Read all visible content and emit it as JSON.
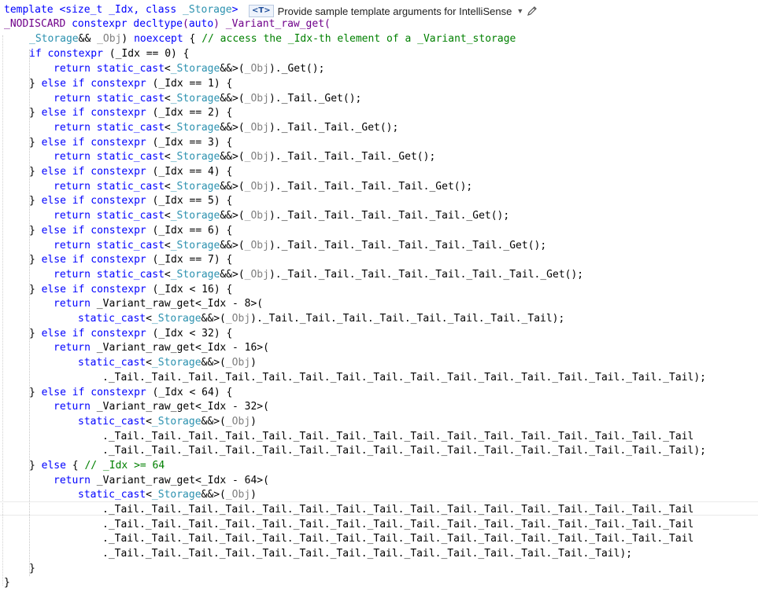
{
  "intellisense": {
    "badge": "<T>",
    "label": "Provide sample template arguments for IntelliSense"
  },
  "code": {
    "l1": "template <size_t _Idx, class _Storage>",
    "l2": "_NODISCARD constexpr decltype(auto) _Variant_raw_get(",
    "l3": "_Storage&& _Obj) noexcept { // access the _Idx-th element of a _Variant_storage",
    "l4": "if constexpr (_Idx == 0) {",
    "l5": "return static_cast<_Storage&&>(_Obj)._Get();",
    "l6": "} else if constexpr (_Idx == 1) {",
    "l7": "return static_cast<_Storage&&>(_Obj)._Tail._Get();",
    "l8": "} else if constexpr (_Idx == 2) {",
    "l9": "return static_cast<_Storage&&>(_Obj)._Tail._Tail._Get();",
    "l10": "} else if constexpr (_Idx == 3) {",
    "l11": "return static_cast<_Storage&&>(_Obj)._Tail._Tail._Tail._Get();",
    "l12": "} else if constexpr (_Idx == 4) {",
    "l13": "return static_cast<_Storage&&>(_Obj)._Tail._Tail._Tail._Tail._Get();",
    "l14": "} else if constexpr (_Idx == 5) {",
    "l15": "return static_cast<_Storage&&>(_Obj)._Tail._Tail._Tail._Tail._Tail._Get();",
    "l16": "} else if constexpr (_Idx == 6) {",
    "l17": "return static_cast<_Storage&&>(_Obj)._Tail._Tail._Tail._Tail._Tail._Tail._Get();",
    "l18": "} else if constexpr (_Idx == 7) {",
    "l19": "return static_cast<_Storage&&>(_Obj)._Tail._Tail._Tail._Tail._Tail._Tail._Tail._Get();",
    "l20": "} else if constexpr (_Idx < 16) {",
    "l21": "return _Variant_raw_get<_Idx - 8>(",
    "l22": "static_cast<_Storage&&>(_Obj)._Tail._Tail._Tail._Tail._Tail._Tail._Tail._Tail);",
    "l23": "} else if constexpr (_Idx < 32) {",
    "l24": "return _Variant_raw_get<_Idx - 16>(",
    "l25": "static_cast<_Storage&&>(_Obj)",
    "l26": "._Tail._Tail._Tail._Tail._Tail._Tail._Tail._Tail._Tail._Tail._Tail._Tail._Tail._Tail._Tail._Tail);",
    "l27": "} else if constexpr (_Idx < 64) {",
    "l28": "return _Variant_raw_get<_Idx - 32>(",
    "l29": "static_cast<_Storage&&>(_Obj)",
    "l30": "._Tail._Tail._Tail._Tail._Tail._Tail._Tail._Tail._Tail._Tail._Tail._Tail._Tail._Tail._Tail._Tail",
    "l31": "._Tail._Tail._Tail._Tail._Tail._Tail._Tail._Tail._Tail._Tail._Tail._Tail._Tail._Tail._Tail._Tail);",
    "l32": "} else { // _Idx >= 64",
    "l33": "return _Variant_raw_get<_Idx - 64>(",
    "l34": "static_cast<_Storage&&>(_Obj)",
    "l35": "._Tail._Tail._Tail._Tail._Tail._Tail._Tail._Tail._Tail._Tail._Tail._Tail._Tail._Tail._Tail._Tail",
    "l36": "._Tail._Tail._Tail._Tail._Tail._Tail._Tail._Tail._Tail._Tail._Tail._Tail._Tail._Tail._Tail._Tail",
    "l37": "._Tail._Tail._Tail._Tail._Tail._Tail._Tail._Tail._Tail._Tail._Tail._Tail._Tail._Tail._Tail._Tail",
    "l38": "._Tail._Tail._Tail._Tail._Tail._Tail._Tail._Tail._Tail._Tail._Tail._Tail._Tail._Tail);",
    "l39": "}",
    "l40": "}"
  }
}
